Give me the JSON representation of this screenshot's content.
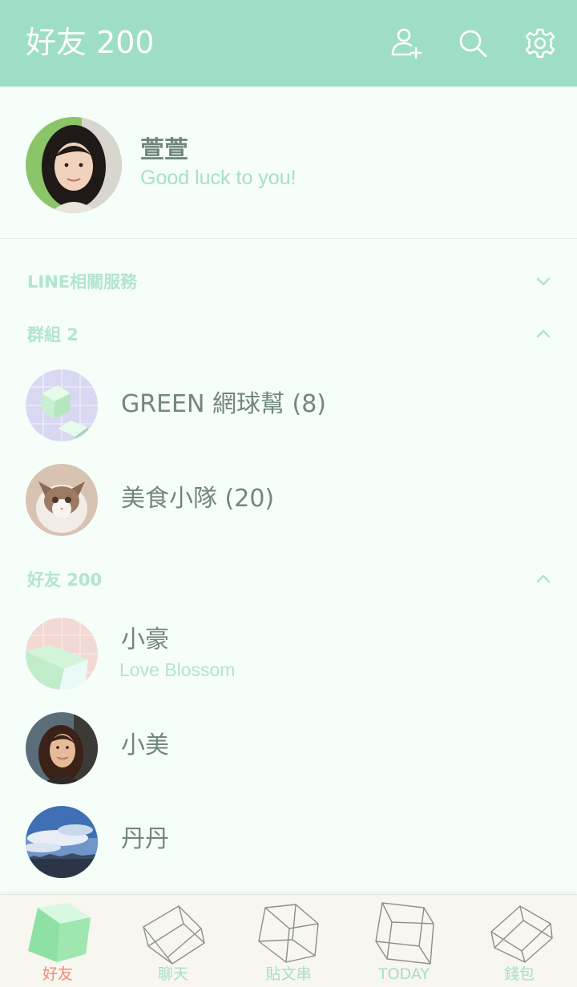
{
  "header": {
    "title": "好友 200",
    "icons": [
      "add-friend-icon",
      "search-icon",
      "gear-icon"
    ]
  },
  "profile": {
    "name": "萱萱",
    "status": "Good luck to you!"
  },
  "sections": {
    "line_services": {
      "label": "LINE相關服務",
      "expanded": false
    },
    "groups": {
      "label": "群組 2",
      "expanded": true
    },
    "friends": {
      "label": "好友 200",
      "expanded": true
    }
  },
  "groups": [
    {
      "name": "GREEN 網球幫 (8)"
    },
    {
      "name": "美食小隊 (20)"
    }
  ],
  "friends": [
    {
      "name": "小豪",
      "status": "Love Blossom"
    },
    {
      "name": "小美"
    },
    {
      "name": "丹丹"
    }
  ],
  "tabs": [
    {
      "label": "好友",
      "active": true
    },
    {
      "label": "聊天",
      "active": false
    },
    {
      "label": "貼文串",
      "active": false
    },
    {
      "label": "TODAY",
      "active": false
    },
    {
      "label": "錢包",
      "active": false
    }
  ],
  "colors": {
    "header_bg": "#9edec5",
    "page_bg": "#f5fef9",
    "name_text": "#71877a",
    "accent_light": "#a7dfc6",
    "active_tab": "#f08b72",
    "tabbar_bg": "#f7f6ef"
  }
}
